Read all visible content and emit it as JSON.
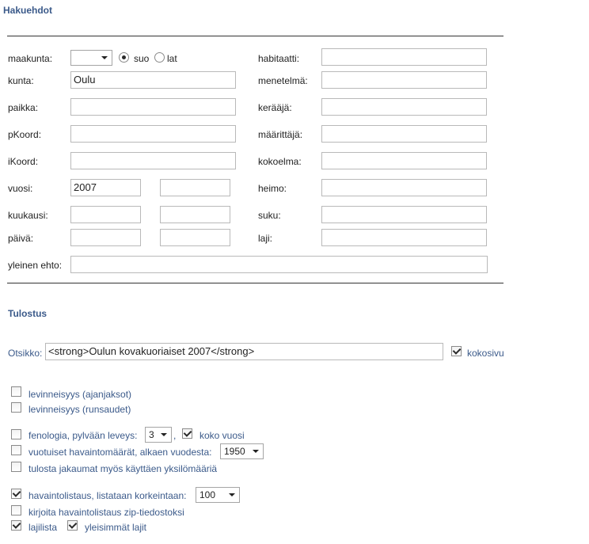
{
  "search": {
    "heading": "Hakuehdot",
    "maakunta_label": "maakunta:",
    "maakunta_value": "",
    "radio_suo": "suo",
    "radio_lat": "lat",
    "kunta_label": "kunta:",
    "kunta_value": "Oulu",
    "paikka_label": "paikka:",
    "paikka_value": "",
    "pkoord_label": "pKoord:",
    "pkoord_value": "",
    "ikoord_label": "iKoord:",
    "ikoord_value": "",
    "vuosi_label": "vuosi:",
    "vuosi_from": "2007",
    "vuosi_to": "",
    "kuukausi_label": "kuukausi:",
    "kuukausi_from": "",
    "kuukausi_to": "",
    "paiva_label": "päivä:",
    "paiva_from": "",
    "paiva_to": "",
    "yleinen_label": "yleinen ehto:",
    "yleinen_value": "",
    "habitaatti_label": "habitaatti:",
    "menetelma_label": "menetelmä:",
    "keraaja_label": "kerääjä:",
    "maarittaja_label": "määrittäjä:",
    "kokoelma_label": "kokoelma:",
    "heimo_label": "heimo:",
    "suku_label": "suku:",
    "laji_label": "laji:"
  },
  "output": {
    "heading": "Tulostus",
    "otsikko_label": "Otsikko:",
    "otsikko_value": "<strong>Oulun kovakuoriaiset 2007</strong>",
    "kokosivu_label": "kokosivu",
    "levinneisyys_ajanjaksot": "levinneisyys (ajanjaksot)",
    "levinneisyys_runsaudet": "levinneisyys (runsaudet)",
    "fenologia_label": "fenologia,  pylvään leveys:",
    "fenologia_width": "3",
    "koko_vuosi_label": "koko vuosi",
    "vuotuiset_label": "vuotuiset havaintomäärät, alkaen vuodesta:",
    "vuotuiset_year": "1950",
    "tulosta_label": "tulosta jakaumat myös käyttäen yksilömääriä",
    "havaintolistaus_label": "havaintolistaus, listataan korkeintaan:",
    "havaintolistaus_max": "100",
    "zip_label": "kirjoita havaintolistaus zip-tiedostoksi",
    "lajilista_label": "lajilista",
    "yleisimmat_label": "yleisimmät lajit"
  }
}
